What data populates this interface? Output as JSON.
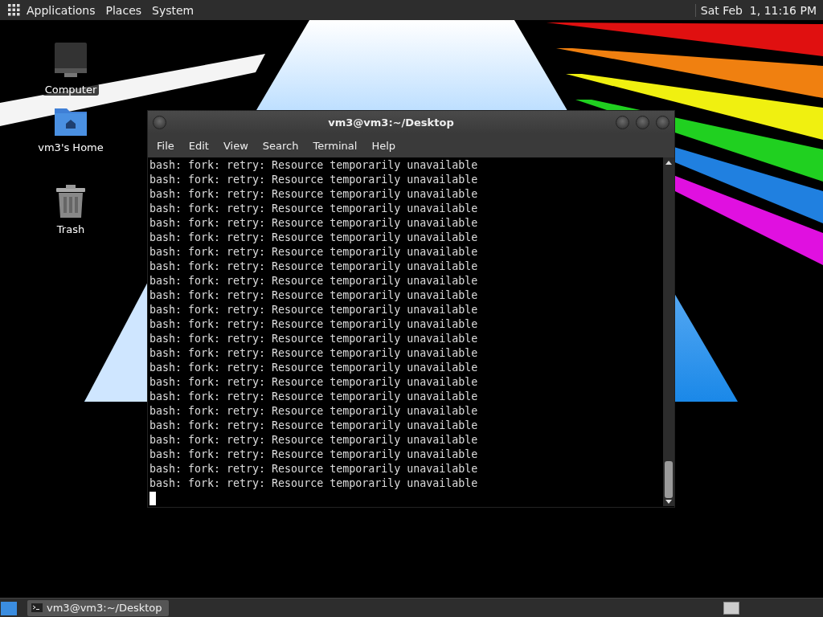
{
  "top_panel": {
    "menus": [
      "Applications",
      "Places",
      "System"
    ],
    "clock": "Sat Feb  1, 11:16 PM"
  },
  "desktop_icons": [
    {
      "kind": "computer",
      "label": "Computer"
    },
    {
      "kind": "home",
      "label": "vm3's Home"
    },
    {
      "kind": "trash",
      "label": "Trash"
    }
  ],
  "terminal": {
    "title": "vm3@vm3:~/Desktop",
    "menu": [
      "File",
      "Edit",
      "View",
      "Search",
      "Terminal",
      "Help"
    ],
    "lines": [
      "bash: fork: retry: Resource temporarily unavailable",
      "bash: fork: retry: Resource temporarily unavailable",
      "bash: fork: retry: Resource temporarily unavailable",
      "bash: fork: retry: Resource temporarily unavailable",
      "bash: fork: retry: Resource temporarily unavailable",
      "bash: fork: retry: Resource temporarily unavailable",
      "bash: fork: retry: Resource temporarily unavailable",
      "bash: fork: retry: Resource temporarily unavailable",
      "bash: fork: retry: Resource temporarily unavailable",
      "bash: fork: retry: Resource temporarily unavailable",
      "bash: fork: retry: Resource temporarily unavailable",
      "bash: fork: retry: Resource temporarily unavailable",
      "bash: fork: retry: Resource temporarily unavailable",
      "bash: fork: retry: Resource temporarily unavailable",
      "bash: fork: retry: Resource temporarily unavailable",
      "bash: fork: retry: Resource temporarily unavailable",
      "bash: fork: retry: Resource temporarily unavailable",
      "bash: fork: retry: Resource temporarily unavailable",
      "bash: fork: retry: Resource temporarily unavailable",
      "bash: fork: retry: Resource temporarily unavailable",
      "bash: fork: retry: Resource temporarily unavailable",
      "bash: fork: retry: Resource temporarily unavailable",
      "bash: fork: retry: Resource temporarily unavailable"
    ]
  },
  "taskbar": {
    "tasks": [
      {
        "label": "vm3@vm3:~/Desktop",
        "selected": true
      }
    ]
  }
}
